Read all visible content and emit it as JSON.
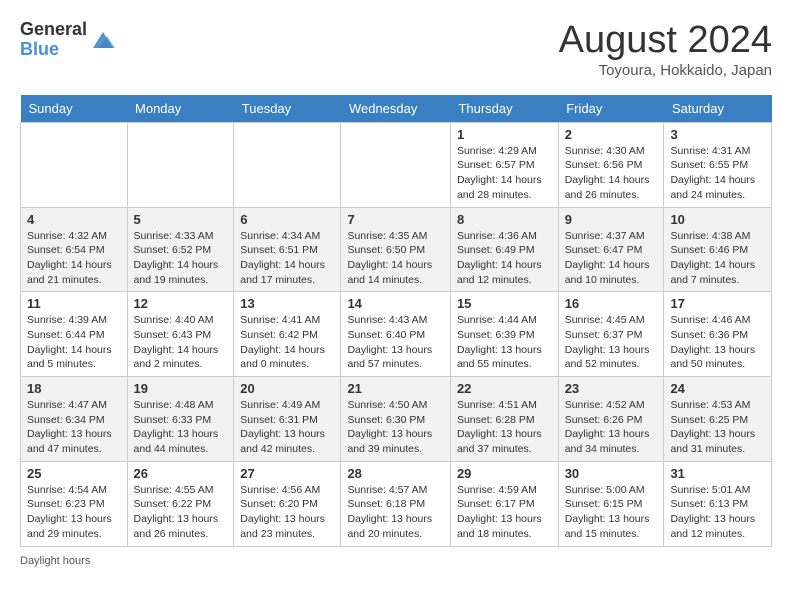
{
  "header": {
    "logo_general": "General",
    "logo_blue": "Blue",
    "month_title": "August 2024",
    "location": "Toyoura, Hokkaido, Japan"
  },
  "weekdays": [
    "Sunday",
    "Monday",
    "Tuesday",
    "Wednesday",
    "Thursday",
    "Friday",
    "Saturday"
  ],
  "weeks": [
    [
      {
        "day": "",
        "detail": ""
      },
      {
        "day": "",
        "detail": ""
      },
      {
        "day": "",
        "detail": ""
      },
      {
        "day": "",
        "detail": ""
      },
      {
        "day": "1",
        "detail": "Sunrise: 4:29 AM\nSunset: 6:57 PM\nDaylight: 14 hours\nand 28 minutes."
      },
      {
        "day": "2",
        "detail": "Sunrise: 4:30 AM\nSunset: 6:56 PM\nDaylight: 14 hours\nand 26 minutes."
      },
      {
        "day": "3",
        "detail": "Sunrise: 4:31 AM\nSunset: 6:55 PM\nDaylight: 14 hours\nand 24 minutes."
      }
    ],
    [
      {
        "day": "4",
        "detail": "Sunrise: 4:32 AM\nSunset: 6:54 PM\nDaylight: 14 hours\nand 21 minutes."
      },
      {
        "day": "5",
        "detail": "Sunrise: 4:33 AM\nSunset: 6:52 PM\nDaylight: 14 hours\nand 19 minutes."
      },
      {
        "day": "6",
        "detail": "Sunrise: 4:34 AM\nSunset: 6:51 PM\nDaylight: 14 hours\nand 17 minutes."
      },
      {
        "day": "7",
        "detail": "Sunrise: 4:35 AM\nSunset: 6:50 PM\nDaylight: 14 hours\nand 14 minutes."
      },
      {
        "day": "8",
        "detail": "Sunrise: 4:36 AM\nSunset: 6:49 PM\nDaylight: 14 hours\nand 12 minutes."
      },
      {
        "day": "9",
        "detail": "Sunrise: 4:37 AM\nSunset: 6:47 PM\nDaylight: 14 hours\nand 10 minutes."
      },
      {
        "day": "10",
        "detail": "Sunrise: 4:38 AM\nSunset: 6:46 PM\nDaylight: 14 hours\nand 7 minutes."
      }
    ],
    [
      {
        "day": "11",
        "detail": "Sunrise: 4:39 AM\nSunset: 6:44 PM\nDaylight: 14 hours\nand 5 minutes."
      },
      {
        "day": "12",
        "detail": "Sunrise: 4:40 AM\nSunset: 6:43 PM\nDaylight: 14 hours\nand 2 minutes."
      },
      {
        "day": "13",
        "detail": "Sunrise: 4:41 AM\nSunset: 6:42 PM\nDaylight: 14 hours\nand 0 minutes."
      },
      {
        "day": "14",
        "detail": "Sunrise: 4:43 AM\nSunset: 6:40 PM\nDaylight: 13 hours\nand 57 minutes."
      },
      {
        "day": "15",
        "detail": "Sunrise: 4:44 AM\nSunset: 6:39 PM\nDaylight: 13 hours\nand 55 minutes."
      },
      {
        "day": "16",
        "detail": "Sunrise: 4:45 AM\nSunset: 6:37 PM\nDaylight: 13 hours\nand 52 minutes."
      },
      {
        "day": "17",
        "detail": "Sunrise: 4:46 AM\nSunset: 6:36 PM\nDaylight: 13 hours\nand 50 minutes."
      }
    ],
    [
      {
        "day": "18",
        "detail": "Sunrise: 4:47 AM\nSunset: 6:34 PM\nDaylight: 13 hours\nand 47 minutes."
      },
      {
        "day": "19",
        "detail": "Sunrise: 4:48 AM\nSunset: 6:33 PM\nDaylight: 13 hours\nand 44 minutes."
      },
      {
        "day": "20",
        "detail": "Sunrise: 4:49 AM\nSunset: 6:31 PM\nDaylight: 13 hours\nand 42 minutes."
      },
      {
        "day": "21",
        "detail": "Sunrise: 4:50 AM\nSunset: 6:30 PM\nDaylight: 13 hours\nand 39 minutes."
      },
      {
        "day": "22",
        "detail": "Sunrise: 4:51 AM\nSunset: 6:28 PM\nDaylight: 13 hours\nand 37 minutes."
      },
      {
        "day": "23",
        "detail": "Sunrise: 4:52 AM\nSunset: 6:26 PM\nDaylight: 13 hours\nand 34 minutes."
      },
      {
        "day": "24",
        "detail": "Sunrise: 4:53 AM\nSunset: 6:25 PM\nDaylight: 13 hours\nand 31 minutes."
      }
    ],
    [
      {
        "day": "25",
        "detail": "Sunrise: 4:54 AM\nSunset: 6:23 PM\nDaylight: 13 hours\nand 29 minutes."
      },
      {
        "day": "26",
        "detail": "Sunrise: 4:55 AM\nSunset: 6:22 PM\nDaylight: 13 hours\nand 26 minutes."
      },
      {
        "day": "27",
        "detail": "Sunrise: 4:56 AM\nSunset: 6:20 PM\nDaylight: 13 hours\nand 23 minutes."
      },
      {
        "day": "28",
        "detail": "Sunrise: 4:57 AM\nSunset: 6:18 PM\nDaylight: 13 hours\nand 20 minutes."
      },
      {
        "day": "29",
        "detail": "Sunrise: 4:59 AM\nSunset: 6:17 PM\nDaylight: 13 hours\nand 18 minutes."
      },
      {
        "day": "30",
        "detail": "Sunrise: 5:00 AM\nSunset: 6:15 PM\nDaylight: 13 hours\nand 15 minutes."
      },
      {
        "day": "31",
        "detail": "Sunrise: 5:01 AM\nSunset: 6:13 PM\nDaylight: 13 hours\nand 12 minutes."
      }
    ]
  ],
  "footer": {
    "daylight_hours": "Daylight hours"
  }
}
